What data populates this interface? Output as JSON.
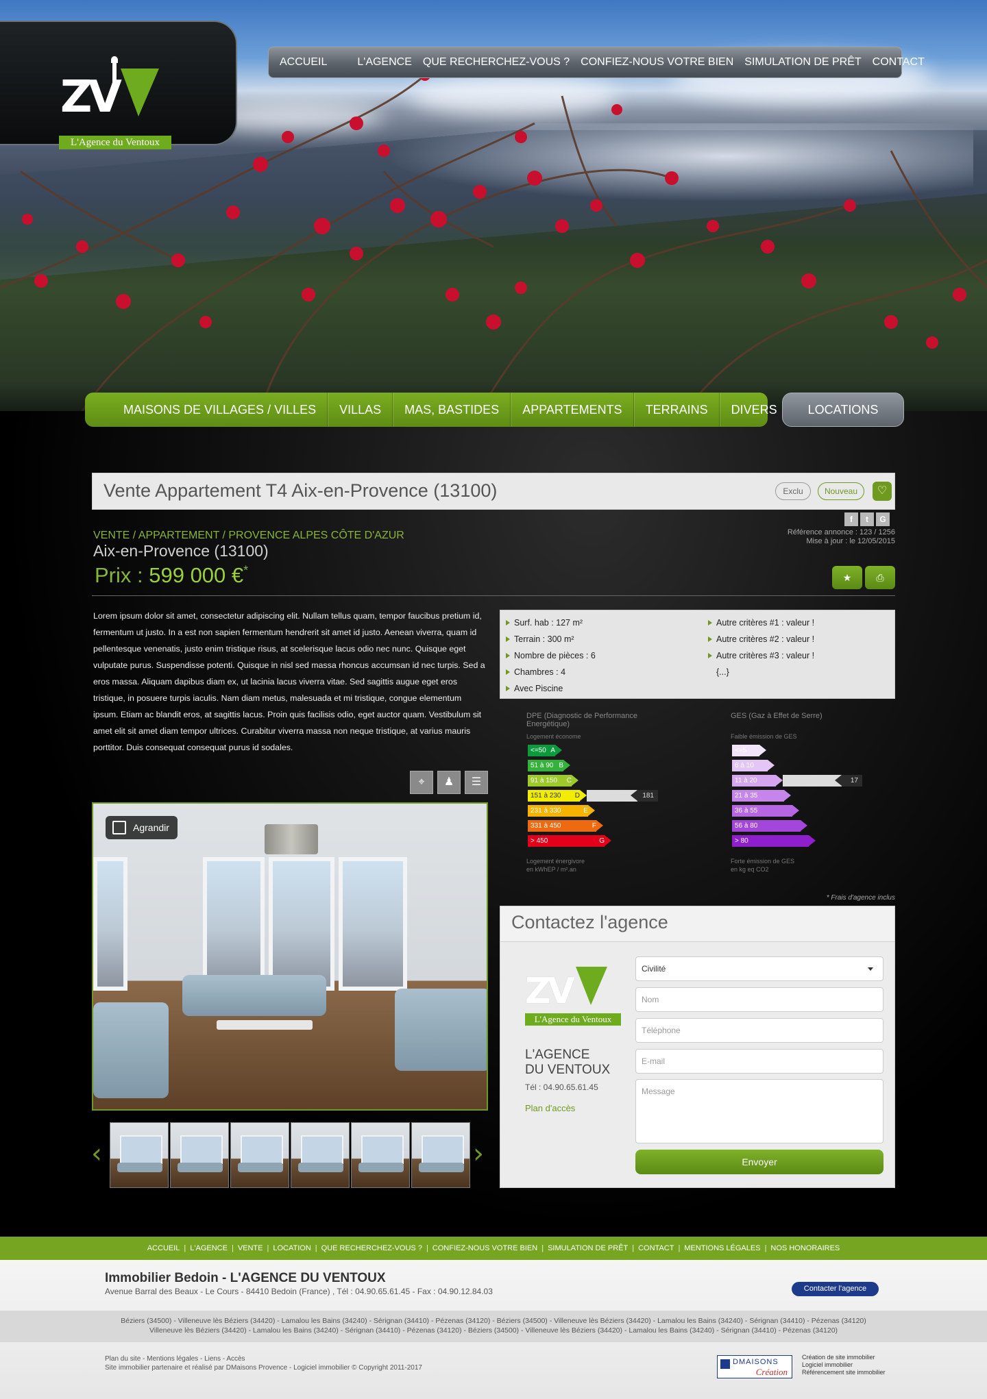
{
  "logo": {
    "band_text": "L'Agence du Ventoux",
    "letters": "ZV"
  },
  "topnav": [
    "ACCUEIL",
    "L'AGENCE",
    "QUE RECHERCHEZ-VOUS ?",
    "CONFIEZ-NOUS VOTRE BIEN",
    "SIMULATION DE PRÊT",
    "CONTACT"
  ],
  "categories": [
    "MAISONS DE VILLAGES / VILLES",
    "VILLAS",
    "MAS, BASTIDES",
    "APPARTEMENTS",
    "TERRAINS",
    "DIVERS"
  ],
  "locations_label": "LOCATIONS",
  "listing": {
    "title": "Vente Appartement T4 Aix-en-Provence (13100)",
    "badge_exclu": "Exclu",
    "badge_nouveau": "Nouveau",
    "heart_icon": "heart-icon",
    "breadcrumb": "VENTE / APPARTEMENT / PROVENCE ALPES CÔTE D'AZUR",
    "city": "Aix-en-Provence (13100)",
    "price_label": "Prix : ",
    "price_value": "599 000 €",
    "price_star": "*",
    "reference": "Référence annonce : 123 / 1256",
    "updated": "Mise à jour : le 12/05/2015",
    "social": [
      "f",
      "t",
      "G"
    ],
    "description": "Lorem ipsum dolor sit amet, consectetur adipiscing elit. Nullam tellus quam, tempor faucibus pretium id, fermentum ut justo. In a est non sapien fermentum hendrerit sit amet id justo. Aenean viverra, quam id pellentesque venenatis, justo enim tristique risus, at scelerisque lacus odio nec nunc. Quisque eget vulputate purus. Suspendisse potenti. Quisque in nisl sed massa rhoncus accumsan id nec turpis. Sed a eros massa. Aliquam dapibus diam ex, ut lacinia lacus viverra vitae. Sed sagittis augue eget eros tristique, in posuere turpis iaculis. Nam diam metus, malesuada et mi tristique, congue elementum ipsum. Etiam ac blandit eros, at sagittis lacus. Proin quis facilisis odio, eget auctor quam. Vestibulum sit amet elit sit amet diam tempor ultrices. Curabitur viverra massa non neque tristique, at varius mauris porttitor. Duis consequat consequat purus id sodales.",
    "criteria_left": [
      "Surf. hab : 127 m²",
      "Terrain : 300 m²",
      "Nombre de pièces : 6",
      "Chambres : 4",
      "Avec Piscine"
    ],
    "criteria_right": [
      "Autre critères #1 : valeur !",
      "Autre critères #2 : valeur !",
      "Autre critères #3 : valeur !",
      "{...}"
    ],
    "frais": "* Frais d'agence inclus",
    "agrandir": "Agrandir",
    "thumbnail_count": 6
  },
  "dpe": {
    "title": "DPE",
    "title_sub": "(Diagnostic de Performance Energétique)",
    "top_label": "Logement économe",
    "bottom_label_1": "Logement énergivore",
    "bottom_label_2": "en kWhEP / m².an",
    "value": "181",
    "active_index": 3,
    "classes": [
      {
        "range": "<=50",
        "letter": "A",
        "color": "#0c9b3b"
      },
      {
        "range": "51 à 90",
        "letter": "B",
        "color": "#35b23c"
      },
      {
        "range": "91 à 150",
        "letter": "C",
        "color": "#9ccb2a"
      },
      {
        "range": "151 à 230",
        "letter": "D",
        "color": "#f2ec00"
      },
      {
        "range": "231 à 330",
        "letter": "E",
        "color": "#f6b400"
      },
      {
        "range": "331 à 450",
        "letter": "F",
        "color": "#ee6a10"
      },
      {
        "range": "> 450",
        "letter": "G",
        "color": "#e2001a"
      }
    ]
  },
  "ges": {
    "title": "GES",
    "title_sub": "(Gaz à Effet de Serre)",
    "top_label": "Faible émission de GES",
    "bottom_label_1": "Forte émission de GES",
    "bottom_label_2": "en kg eq CO2",
    "value": "17",
    "active_index": 2,
    "classes": [
      {
        "range": "<=5",
        "color": "#f3e3fb"
      },
      {
        "range": "6 à 10",
        "color": "#e3c6f5"
      },
      {
        "range": "11 à 20",
        "color": "#d6a5ef"
      },
      {
        "range": "21 à 35",
        "color": "#c685ea"
      },
      {
        "range": "36 à 55",
        "color": "#b666e2"
      },
      {
        "range": "56 à 80",
        "color": "#a346d9"
      },
      {
        "range": "> 80",
        "color": "#8d1fcc"
      }
    ]
  },
  "contact": {
    "title": "Contactez l'agence",
    "agency_name_1": "L'AGENCE",
    "agency_name_2": "DU VENTOUX",
    "tel": "Tél : 04.90.65.61.45",
    "plan": "Plan d'accès",
    "civilite": "Civilité",
    "nom_placeholder": "Nom",
    "telephone_placeholder": "Téléphone",
    "email_placeholder": "E-mail",
    "message_placeholder": "Message",
    "send": "Envoyer"
  },
  "footer": {
    "nav": [
      "ACCUEIL",
      "L'AGENCE",
      "VENTE",
      "LOCATION",
      "QUE RECHERCHEZ-VOUS ?",
      "CONFIEZ-NOUS VOTRE BIEN",
      "SIMULATION DE PRÊT",
      "CONTACT",
      "MENTIONS LÉGALES",
      "NOS HONORAIRES"
    ],
    "title": "Immobilier Bedoin - L'AGENCE DU VENTOUX",
    "address": "Avenue Barral des Beaux - Le Cours - 84410 Bedoin (France) , Tél : 04.90.65.61.45 - Fax : 04.90.12.84.03",
    "cta": "Contacter l'agence",
    "cities_1": "Béziers (34500) - Villeneuve lès Béziers (34420) - Lamalou les Bains (34240) - Sérignan (34410) - Pézenas (34120) - Béziers (34500) - Villeneuve lès Béziers (34420) - Lamalou les Bains (34240) - Sérignan (34410) - Pézenas (34120)",
    "cities_2": "Villeneuve lès Béziers (34420) - Lamalou les Bains (34240) - Sérignan (34410) - Pézenas (34120) - Béziers (34500) - Villeneuve lès Béziers (34420) - Lamalou les Bains (34240) - Sérignan (34410) - Pézenas (34120)",
    "bottom_1": "Plan du site - Mentions légales - Liens - Accès",
    "bottom_2": "Site immobilier partenaire et réalisé par DMaisons Provence - Logiciel immobilier © Copyright 2011-2017",
    "dm_brand": "DMAISONS",
    "dm_script": "Création",
    "dm_lines": [
      "Création de site immobilier",
      "Logiciel immobilier",
      "Référencement site immobilier"
    ]
  }
}
